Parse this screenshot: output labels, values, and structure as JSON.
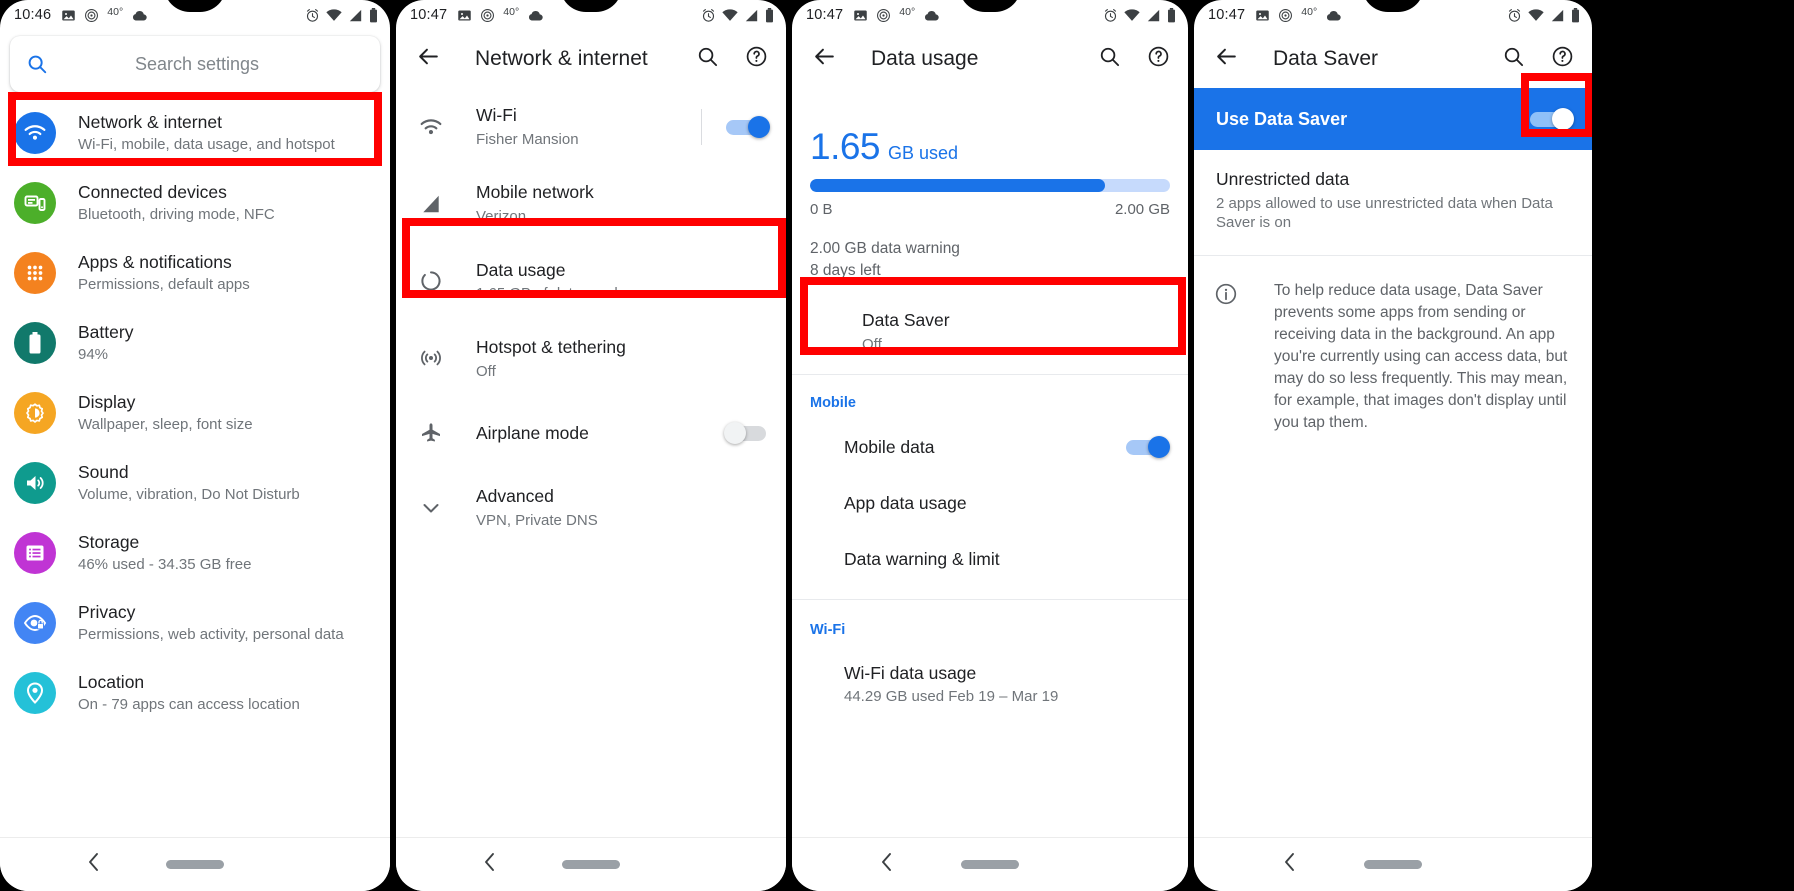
{
  "screens": [
    {
      "id": "settings-home",
      "status": {
        "time": "10:46",
        "temp": "40°"
      },
      "search": {
        "placeholder": "Search settings"
      },
      "items": [
        {
          "title": "Network & internet",
          "sub": "Wi-Fi, mobile, data usage, and hotspot",
          "icon": "wifi-icon",
          "color": "#1a73e8",
          "highlighted": true
        },
        {
          "title": "Connected devices",
          "sub": "Bluetooth, driving mode, NFC",
          "icon": "devices-icon",
          "color": "#4caf2a",
          "highlighted": false
        },
        {
          "title": "Apps & notifications",
          "sub": "Permissions, default apps",
          "icon": "apps-grid-icon",
          "color": "#f4821f",
          "highlighted": false
        },
        {
          "title": "Battery",
          "sub": "94%",
          "icon": "battery-icon",
          "color": "#11796b",
          "highlighted": false
        },
        {
          "title": "Display",
          "sub": "Wallpaper, sleep, font size",
          "icon": "brightness-icon",
          "color": "#f5a623",
          "highlighted": false
        },
        {
          "title": "Sound",
          "sub": "Volume, vibration, Do Not Disturb",
          "icon": "speaker-icon",
          "color": "#0f9b8e",
          "highlighted": false
        },
        {
          "title": "Storage",
          "sub": "46% used - 34.35 GB free",
          "icon": "storage-icon",
          "color": "#c034d4",
          "highlighted": false
        },
        {
          "title": "Privacy",
          "sub": "Permissions, web activity, personal data",
          "icon": "privacy-eye-icon",
          "color": "#4285f4",
          "highlighted": false
        },
        {
          "title": "Location",
          "sub": "On - 79 apps can access location",
          "icon": "location-pin-icon",
          "color": "#24c1d8",
          "highlighted": false
        }
      ]
    },
    {
      "id": "network-internet",
      "status": {
        "time": "10:47",
        "temp": "40°"
      },
      "appbar": {
        "title": "Network & internet",
        "back": "back-arrow-icon",
        "search": "search-icon",
        "help": "help-icon"
      },
      "items": [
        {
          "title": "Wi-Fi",
          "sub": "Fisher Mansion",
          "icon": "wifi-icon",
          "control": "toggle-on",
          "highlighted": false
        },
        {
          "title": "Mobile network",
          "sub": "Verizon",
          "icon": "signal-icon",
          "control": "none",
          "highlighted": false
        },
        {
          "title": "Data usage",
          "sub": "1.65 GB of data used",
          "icon": "data-usage-icon",
          "control": "none",
          "highlighted": true
        },
        {
          "title": "Hotspot & tethering",
          "sub": "Off",
          "icon": "hotspot-icon",
          "control": "none",
          "highlighted": false
        },
        {
          "title": "Airplane mode",
          "sub": "",
          "icon": "airplane-icon",
          "control": "toggle-off",
          "highlighted": false
        },
        {
          "title": "Advanced",
          "sub": "VPN, Private DNS",
          "icon": "chevron-down-icon",
          "control": "none",
          "highlighted": false
        }
      ]
    },
    {
      "id": "data-usage",
      "status": {
        "time": "10:47",
        "temp": "40°"
      },
      "appbar": {
        "title": "Data usage",
        "back": "back-arrow-icon",
        "search": "search-icon",
        "help": "help-icon"
      },
      "usage": {
        "amount": "1.65",
        "unit": "GB used",
        "bar_min_label": "0 B",
        "bar_max_label": "2.00 GB",
        "bar_percent": 82,
        "warning": "2.00 GB data warning",
        "days_left": "8 days left"
      },
      "data_saver": {
        "title": "Data Saver",
        "sub": "Off",
        "highlighted": true
      },
      "sections": [
        {
          "head": "Mobile",
          "rows": [
            {
              "title": "Mobile data",
              "control": "toggle-on"
            },
            {
              "title": "App data usage",
              "control": "none"
            },
            {
              "title": "Data warning & limit",
              "control": "none"
            }
          ]
        },
        {
          "head": "Wi-Fi",
          "rows": [
            {
              "title": "Wi-Fi data usage",
              "sub": "44.29 GB used Feb 19 – Mar 19",
              "control": "none"
            }
          ]
        }
      ]
    },
    {
      "id": "data-saver",
      "status": {
        "time": "10:47",
        "temp": "40°"
      },
      "appbar": {
        "title": "Data Saver",
        "back": "back-arrow-icon",
        "search": "search-icon",
        "help": "help-icon"
      },
      "use_data_saver": {
        "title": "Use Data Saver",
        "control": "toggle-on",
        "highlighted": true
      },
      "unrestricted": {
        "title": "Unrestricted data",
        "sub": "2 apps allowed to use unrestricted data when Data Saver is on"
      },
      "info": {
        "icon": "info-icon",
        "text": "To help reduce data usage, Data Saver prevents some apps from sending or receiving data in the background. An app you're currently using can access data, but may do so less frequently. This may mean, for example, that images don't display until you tap them."
      }
    }
  ],
  "colors": {
    "accent": "#1a73e8",
    "annotation": "#ff0000",
    "text_primary": "#202124",
    "text_secondary": "#70757a"
  },
  "navbar": {
    "back": "nav-back-icon",
    "pill": "nav-home-pill"
  }
}
